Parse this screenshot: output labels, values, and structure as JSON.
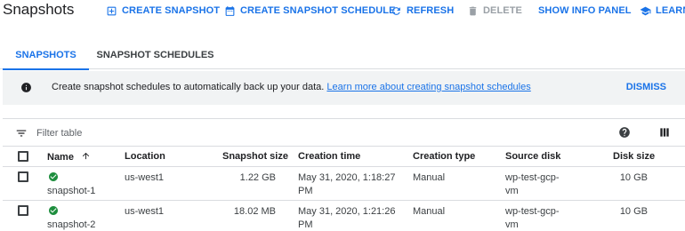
{
  "header": {
    "title": "Snapshots",
    "actions": {
      "create_snapshot": "CREATE SNAPSHOT",
      "create_schedule": "CREATE SNAPSHOT SCHEDULE",
      "refresh": "REFRESH",
      "delete": "DELETE",
      "show_info_panel": "SHOW INFO PANEL",
      "learn": "LEARN"
    }
  },
  "tabs": [
    {
      "label": "SNAPSHOTS",
      "active": true
    },
    {
      "label": "SNAPSHOT SCHEDULES",
      "active": false
    }
  ],
  "banner": {
    "text": "Create snapshot schedules to automatically back up your data.",
    "link": "Learn more about creating snapshot schedules",
    "dismiss": "DISMISS"
  },
  "filter": {
    "placeholder": "Filter table"
  },
  "table": {
    "columns": [
      "Name",
      "Location",
      "Snapshot size",
      "Creation time",
      "Creation type",
      "Source disk",
      "Disk size"
    ],
    "rows": [
      {
        "name": "snapshot-1",
        "status": "ok",
        "location": "us-west1",
        "size": "1.22 GB",
        "creation_time_1": "May 31, 2020, 1:18:27",
        "creation_time_2": "PM",
        "type": "Manual",
        "source_disk_1": "wp-test-gcp-",
        "source_disk_2": "vm",
        "disk_size": "10 GB"
      },
      {
        "name": "snapshot-2",
        "status": "ok",
        "location": "us-west1",
        "size": "18.02 MB",
        "creation_time_1": "May 31, 2020, 1:21:26",
        "creation_time_2": "PM",
        "type": "Manual",
        "source_disk_1": "wp-test-gcp-",
        "source_disk_2": "vm",
        "disk_size": "10 GB"
      }
    ]
  },
  "colors": {
    "accent": "#1a73e8",
    "success": "#1e8e3e",
    "disabled": "#9aa0a6",
    "banner_bg": "#f1f3f4"
  }
}
